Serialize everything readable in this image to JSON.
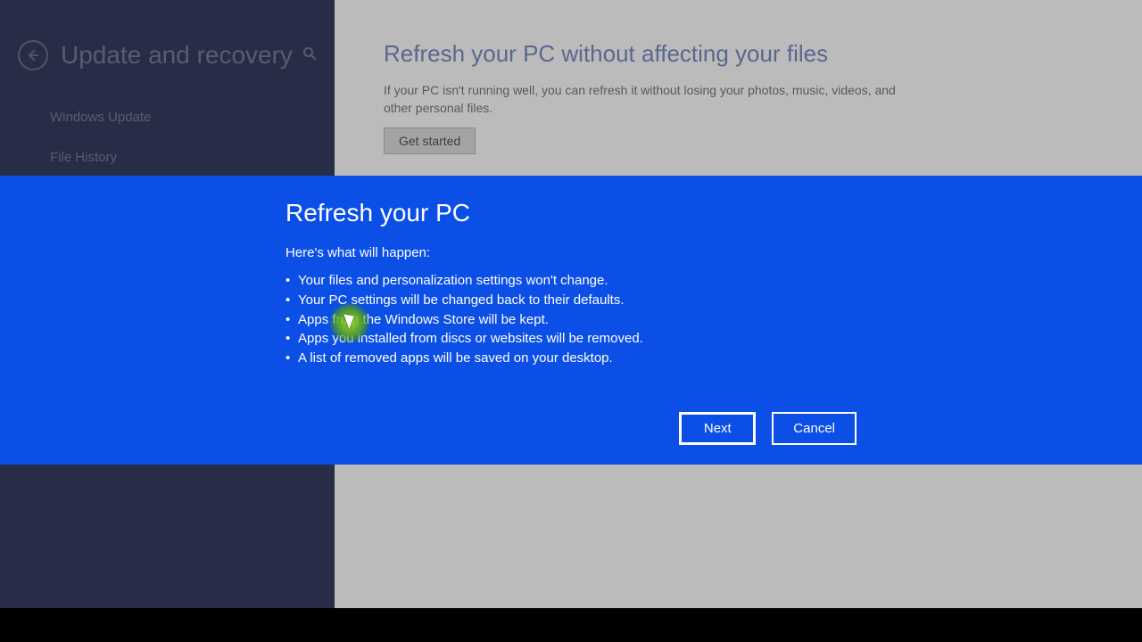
{
  "sidebar": {
    "title": "Update and recovery",
    "items": [
      "Windows Update",
      "File History"
    ]
  },
  "content": {
    "section_title": "Refresh your PC without affecting your files",
    "section_desc": "If your PC isn't running well, you can refresh it without losing your photos, music, videos, and other personal files.",
    "get_started": "Get started"
  },
  "modal": {
    "title": "Refresh your PC",
    "subtitle": "Here's what will happen:",
    "points": [
      "Your files and personalization settings won't change.",
      "Your PC settings will be changed back to their defaults.",
      "Apps from the Windows Store will be kept.",
      "Apps you installed from discs or websites will be removed.",
      "A list of removed apps will be saved on your desktop."
    ],
    "next": "Next",
    "cancel": "Cancel"
  }
}
